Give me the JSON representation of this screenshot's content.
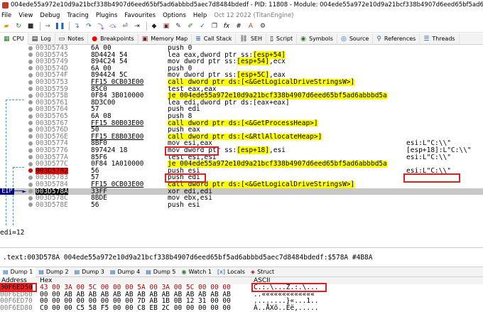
{
  "window_title": "004ede55a972e10d9a21bcf338b4907d6eed65bf5ad6abbbd5aec7d8484bdedf - PID: 11808 - Module: 004ede55a972e10d9a21bcf338b4907d6eed65bf5ad6abbbd5aec7d8484bdedf - T",
  "menu": [
    "File",
    "View",
    "Debug",
    "Tracing",
    "Plugins",
    "Favourites",
    "Options",
    "Help"
  ],
  "build_info": "Oct 12 2022 (TitanEngine)",
  "toolbar_icons": [
    "open-icon",
    "restart-icon",
    "close-icon",
    "run-icon",
    "pause-icon",
    "step-into-icon",
    "step-over-icon",
    "trace-into-icon",
    "trace-over-icon",
    "execute-till-return-icon",
    "run-to-user-code-icon",
    "scylla-icon",
    "memory-icon",
    "patch-icon",
    "comment-icon",
    "label-icon",
    "bookmark-icon",
    "function-icon",
    "hash-icon",
    "strings-icon",
    "calls-icon"
  ],
  "tabs": [
    {
      "label": "CPU",
      "icon": "cpu-icon"
    },
    {
      "label": "Log",
      "icon": "log-icon"
    },
    {
      "label": "Notes",
      "icon": "notes-icon"
    },
    {
      "label": "Breakpoints",
      "icon": "breakpoint-icon"
    },
    {
      "label": "Memory Map",
      "icon": "memory-map-icon"
    },
    {
      "label": "Call Stack",
      "icon": "call-stack-icon"
    },
    {
      "label": "SEH",
      "icon": "seh-icon"
    },
    {
      "label": "Script",
      "icon": "script-icon"
    },
    {
      "label": "Symbols",
      "icon": "symbols-icon"
    },
    {
      "label": "Source",
      "icon": "source-icon"
    },
    {
      "label": "References",
      "icon": "references-icon"
    },
    {
      "label": "Threads",
      "icon": "threads-icon"
    }
  ],
  "disasm": [
    {
      "addr": "003D5743",
      "bytes": "6A 00",
      "instr": "push 0",
      "cmt": ""
    },
    {
      "addr": "003D5745",
      "bytes": "8D4424 54",
      "instr": "lea eax,dword ptr ss:[esp+54]",
      "cmt": ""
    },
    {
      "addr": "003D5749",
      "bytes": "894C24 54",
      "instr": "mov dword ptr ss:[esp+54],ecx",
      "cmt": ""
    },
    {
      "addr": "003D574D",
      "bytes": "6A 00",
      "instr": "push 0",
      "cmt": ""
    },
    {
      "addr": "003D574F",
      "bytes": "894424 5C",
      "instr": "mov dword ptr ss:[esp+5C],eax",
      "cmt": ""
    },
    {
      "addr": "003D5753",
      "bytes": "FF15 0CB03E00",
      "instr": "call dword ptr ds:[<&GetLogicalDriveStringsW>]",
      "cmt": ""
    },
    {
      "addr": "003D5759",
      "bytes": "85C0",
      "instr": "test eax,eax",
      "cmt": ""
    },
    {
      "addr": "003D575B",
      "bytes": "0F84 3B010000",
      "instr": "je 004ede55a972e10d9a21bcf338b4907d6eed65bf5ad6abbbd5a",
      "cmt": ""
    },
    {
      "addr": "003D5761",
      "bytes": "8D3C00",
      "instr": "lea edi,dword ptr ds:[eax+eax]",
      "cmt": ""
    },
    {
      "addr": "003D5764",
      "bytes": "57",
      "instr": "push edi",
      "cmt": ""
    },
    {
      "addr": "003D5765",
      "bytes": "6A 08",
      "instr": "push 8",
      "cmt": ""
    },
    {
      "addr": "003D5767",
      "bytes": "FF15 80B03E00",
      "instr": "call dword ptr ds:[<&GetProcessHeap>]",
      "cmt": ""
    },
    {
      "addr": "003D576D",
      "bytes": "50",
      "instr": "push eax",
      "cmt": ""
    },
    {
      "addr": "003D576E",
      "bytes": "FF15 E8B03E00",
      "instr": "call dword ptr ds:[<&RtlAllocateHeap>]",
      "cmt": ""
    },
    {
      "addr": "003D5774",
      "bytes": "8BF0",
      "instr": "mov esi,eax",
      "cmt": "esi:L\"C:\\\\\""
    },
    {
      "addr": "003D5776",
      "bytes": "897424 18",
      "instr": "mov dword ptr ss:[esp+18],esi",
      "cmt": "[esp+18]:L\"C:\\\\\""
    },
    {
      "addr": "003D577A",
      "bytes": "85F6",
      "instr": "test esi,esi",
      "cmt": "esi:L\"C:\\\\\""
    },
    {
      "addr": "003D577C",
      "bytes": "0F84 1A010000",
      "instr": "je 004ede55a972e10d9a21bcf338b4907d6eed65bf5ad6abbbd5a",
      "cmt": ""
    },
    {
      "addr": "003D5782",
      "bytes": "56",
      "instr": "push esi",
      "cmt": "esi:L\"C:\\\\\""
    },
    {
      "addr": "003D5783",
      "bytes": "57",
      "instr": "push edi",
      "cmt": ""
    },
    {
      "addr": "003D5784",
      "bytes": "FF15 0CB03E00",
      "instr": "call dword ptr ds:[<&GetLogicalDriveStringsW>]",
      "cmt": ""
    },
    {
      "addr": "003D578A",
      "bytes": "33FF",
      "instr": "xor edi,edi",
      "cmt": ""
    },
    {
      "addr": "003D578C",
      "bytes": "8BDE",
      "instr": "mov ebx,esi",
      "cmt": ""
    },
    {
      "addr": "003D578E",
      "bytes": "56",
      "instr": "push esi",
      "cmt": ""
    }
  ],
  "eip_label": "EIP",
  "register_info": "edi=12",
  "location_info": ".text:003D578A 004ede55a972e10d9a21bcf338b4907d6eed65bf5ad6abbbd5aec7d8484bdedf:$578A #4B8A",
  "dump_tabs": [
    {
      "label": "Dump 1",
      "icon": "dump-icon"
    },
    {
      "label": "Dump 2",
      "icon": "dump-icon"
    },
    {
      "label": "Dump 3",
      "icon": "dump-icon"
    },
    {
      "label": "Dump 4",
      "icon": "dump-icon"
    },
    {
      "label": "Dump 5",
      "icon": "dump-icon"
    },
    {
      "label": "Watch 1",
      "icon": "watch-icon"
    },
    {
      "label": "Locals",
      "icon": "locals-icon"
    },
    {
      "label": "Struct",
      "icon": "struct-icon"
    }
  ],
  "dump_headers": {
    "address": "Address",
    "hex": "Hex",
    "ascii": "ASCII"
  },
  "dump_rows": [
    {
      "addr": "00F6ED50",
      "hex": "43 00 3A 00 5C 00 00 00 5A 00 3A 00 5C 00 00 00",
      "ascii": "C.:.\\...Z.:.\\..."
    },
    {
      "addr": "00F6ED60",
      "hex": "00 00 AB AB AB AB AB AB AB AB AB AB AB AB AB AB",
      "ascii": "..«««««««««««««"
    },
    {
      "addr": "00F6ED70",
      "hex": "00 00 00 00 00 00 00 00 7D AB 1B 0B 12 31 00 00",
      "ascii": "........}«...1.."
    },
    {
      "addr": "00F6ED80",
      "hex": "C0 00 00 C5 58 F5 00 00 C8 EB 2C 00 00 00 00 00",
      "ascii": "À..ÅXõ..Èë,....."
    }
  ]
}
